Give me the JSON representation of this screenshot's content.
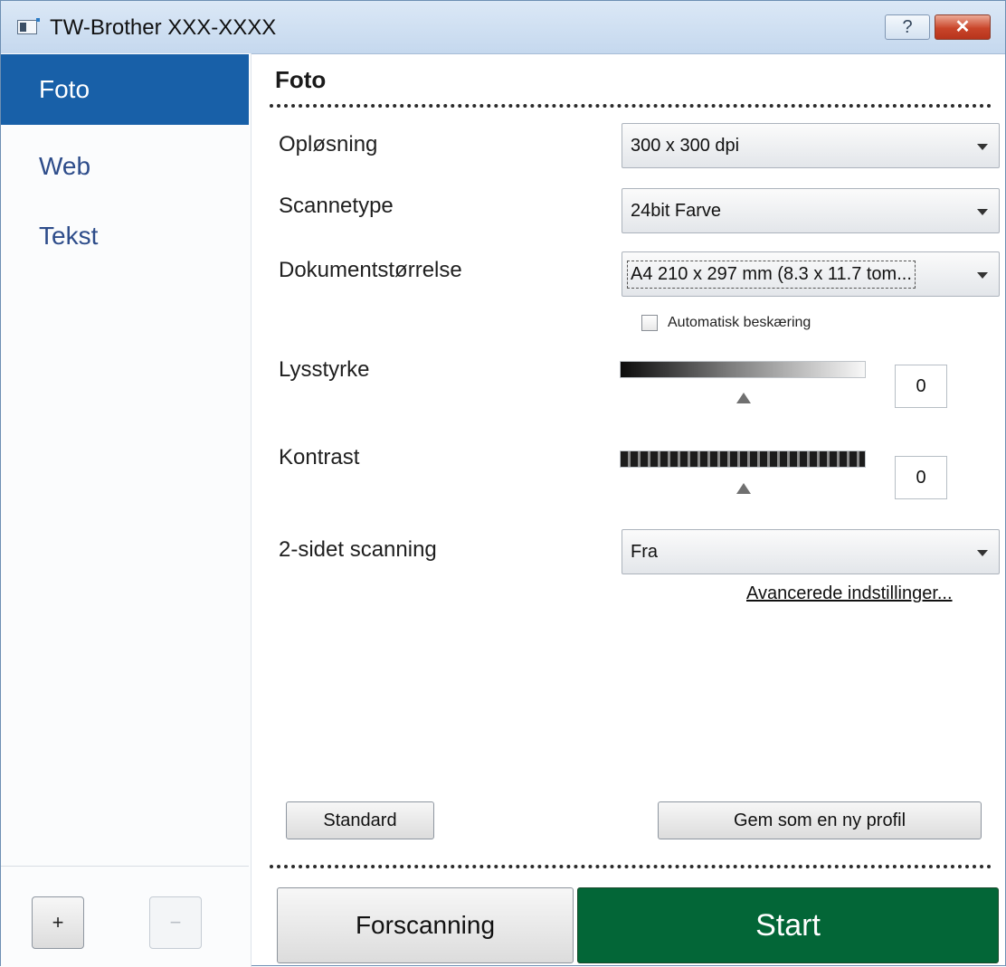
{
  "window": {
    "title": "TW-Brother XXX-XXXX",
    "help_label": "?",
    "close_label": "✕"
  },
  "sidebar": {
    "items": [
      {
        "label": "Foto",
        "selected": true
      },
      {
        "label": "Web",
        "selected": false
      },
      {
        "label": "Tekst",
        "selected": false
      }
    ],
    "add_label": "+",
    "remove_label": "−"
  },
  "main": {
    "section_title": "Foto",
    "resolution": {
      "label": "Opløsning",
      "value": "300 x 300 dpi"
    },
    "scan_type": {
      "label": "Scannetype",
      "value": "24bit Farve"
    },
    "document_size": {
      "label": "Dokumentstørrelse",
      "value": "A4 210 x 297 mm (8.3 x 11.7 tom..."
    },
    "auto_crop": {
      "label": "Automatisk beskæring",
      "checked": false
    },
    "brightness": {
      "label": "Lysstyrke",
      "value": "0"
    },
    "contrast": {
      "label": "Kontrast",
      "value": "0"
    },
    "duplex": {
      "label": "2-sidet scanning",
      "value": "Fra"
    },
    "advanced_link": "Avancerede indstillinger...",
    "default_button": "Standard",
    "save_profile_button": "Gem som en ny profil",
    "prescan_button": "Forscanning",
    "start_button": "Start"
  },
  "colors": {
    "accent": "#1860a8",
    "start": "#036637"
  }
}
